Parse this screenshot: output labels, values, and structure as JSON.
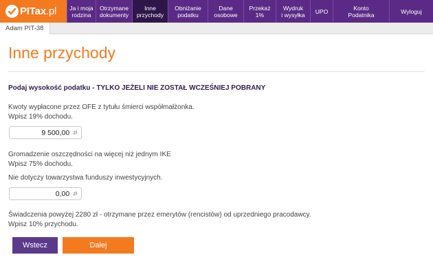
{
  "brand": {
    "name_bold": "PITax",
    "name_light": ".pl"
  },
  "nav": {
    "items": [
      {
        "label": "Ja i moja\nrodzina",
        "active": false
      },
      {
        "label": "Otrzymane\ndokumenty",
        "active": false
      },
      {
        "label": "Inne\nprzychody",
        "active": true
      },
      {
        "label": "Obniżanie\npodatku",
        "active": false
      },
      {
        "label": "Dane\nosobowe",
        "active": false
      },
      {
        "label": "Przekaż\n1%",
        "active": false
      },
      {
        "label": "Wydruk\ni wysyłka",
        "active": false
      },
      {
        "label": "UPO",
        "active": false
      },
      {
        "label": "Konto\nPodatnika",
        "active": false
      },
      {
        "label": "Wyloguj",
        "active": false
      }
    ]
  },
  "user_tab": "Adam PIT-38",
  "page": {
    "title": "Inne przychody",
    "heading": "Podaj wysokość podatku - TYLKO JEŻELI NIE ZOSTAŁ WCZEŚNIEJ POBRANY"
  },
  "fields": [
    {
      "desc1": "Kwoty wypłacone przez OFE z tytułu śmierci współmałżonka.",
      "desc2": "Wpisz 19% dochodu.",
      "value": "9 500,00",
      "currency": "zł"
    },
    {
      "desc1": "Gromadzenie oszczędności na więcej niż jednym IKE",
      "desc2": "Wpisz 75% dochodu.",
      "desc3": "Nie dotyczy towarzystwa funduszy inwestycyjnych.",
      "value": "0,00",
      "currency": "zł"
    },
    {
      "desc1": "Świadczenia powyżej 2280 zł - otrzymane przez emerytów (rencistów) od uprzedniego pracodawcy.",
      "desc2": "Wpisz 10% przychodu."
    }
  ],
  "buttons": {
    "back": "Wstecz",
    "next": "Dalej"
  },
  "colors": {
    "brand_orange": "#f47a20",
    "nav_purple": "#5b2a86",
    "nav_active": "#2e1748",
    "back_button": "#5b3a8c"
  }
}
